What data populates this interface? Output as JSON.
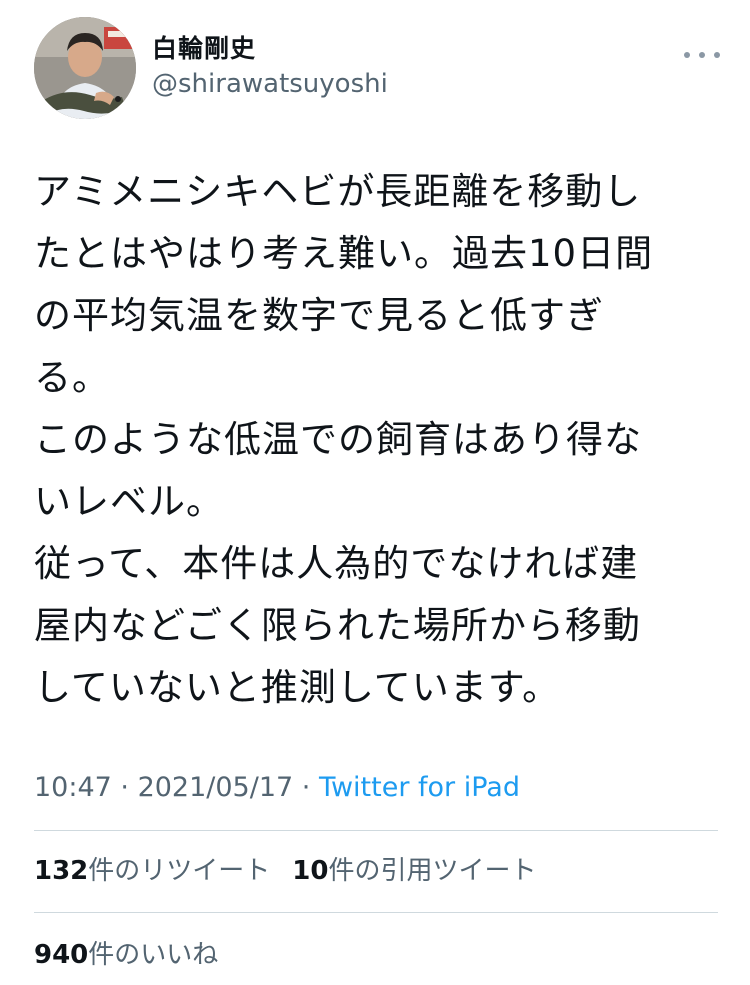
{
  "user": {
    "display_name": "白輪剛史",
    "handle": "@shirawatsuyoshi",
    "avatar_icon": "profile-photo-avatar"
  },
  "tweet": {
    "lines": [
      "アミメニシキヘビが長距離を移動し",
      "たとはやはり考え難い。過去10日間",
      "の平均気温を数字で見ると低すぎ",
      "る。",
      "このような低温での飼育はあり得な",
      "いレベル。",
      "従って、本件は人為的でなければ建",
      "屋内などごく限られた場所から移動",
      "していないと推測しています。"
    ]
  },
  "meta": {
    "time": "10:47",
    "separator": " · ",
    "date": "2021/05/17",
    "source": "Twitter for iPad"
  },
  "stats": {
    "retweets_count": "132",
    "retweets_label": "件のリツイート",
    "quotes_count": "10",
    "quotes_label": "件の引用ツイート",
    "likes_count": "940",
    "likes_label": "件のいいね"
  },
  "colors": {
    "text_primary": "#0f1419",
    "text_secondary": "#536471",
    "link": "#1d9bf0",
    "divider": "#cfd9de"
  }
}
